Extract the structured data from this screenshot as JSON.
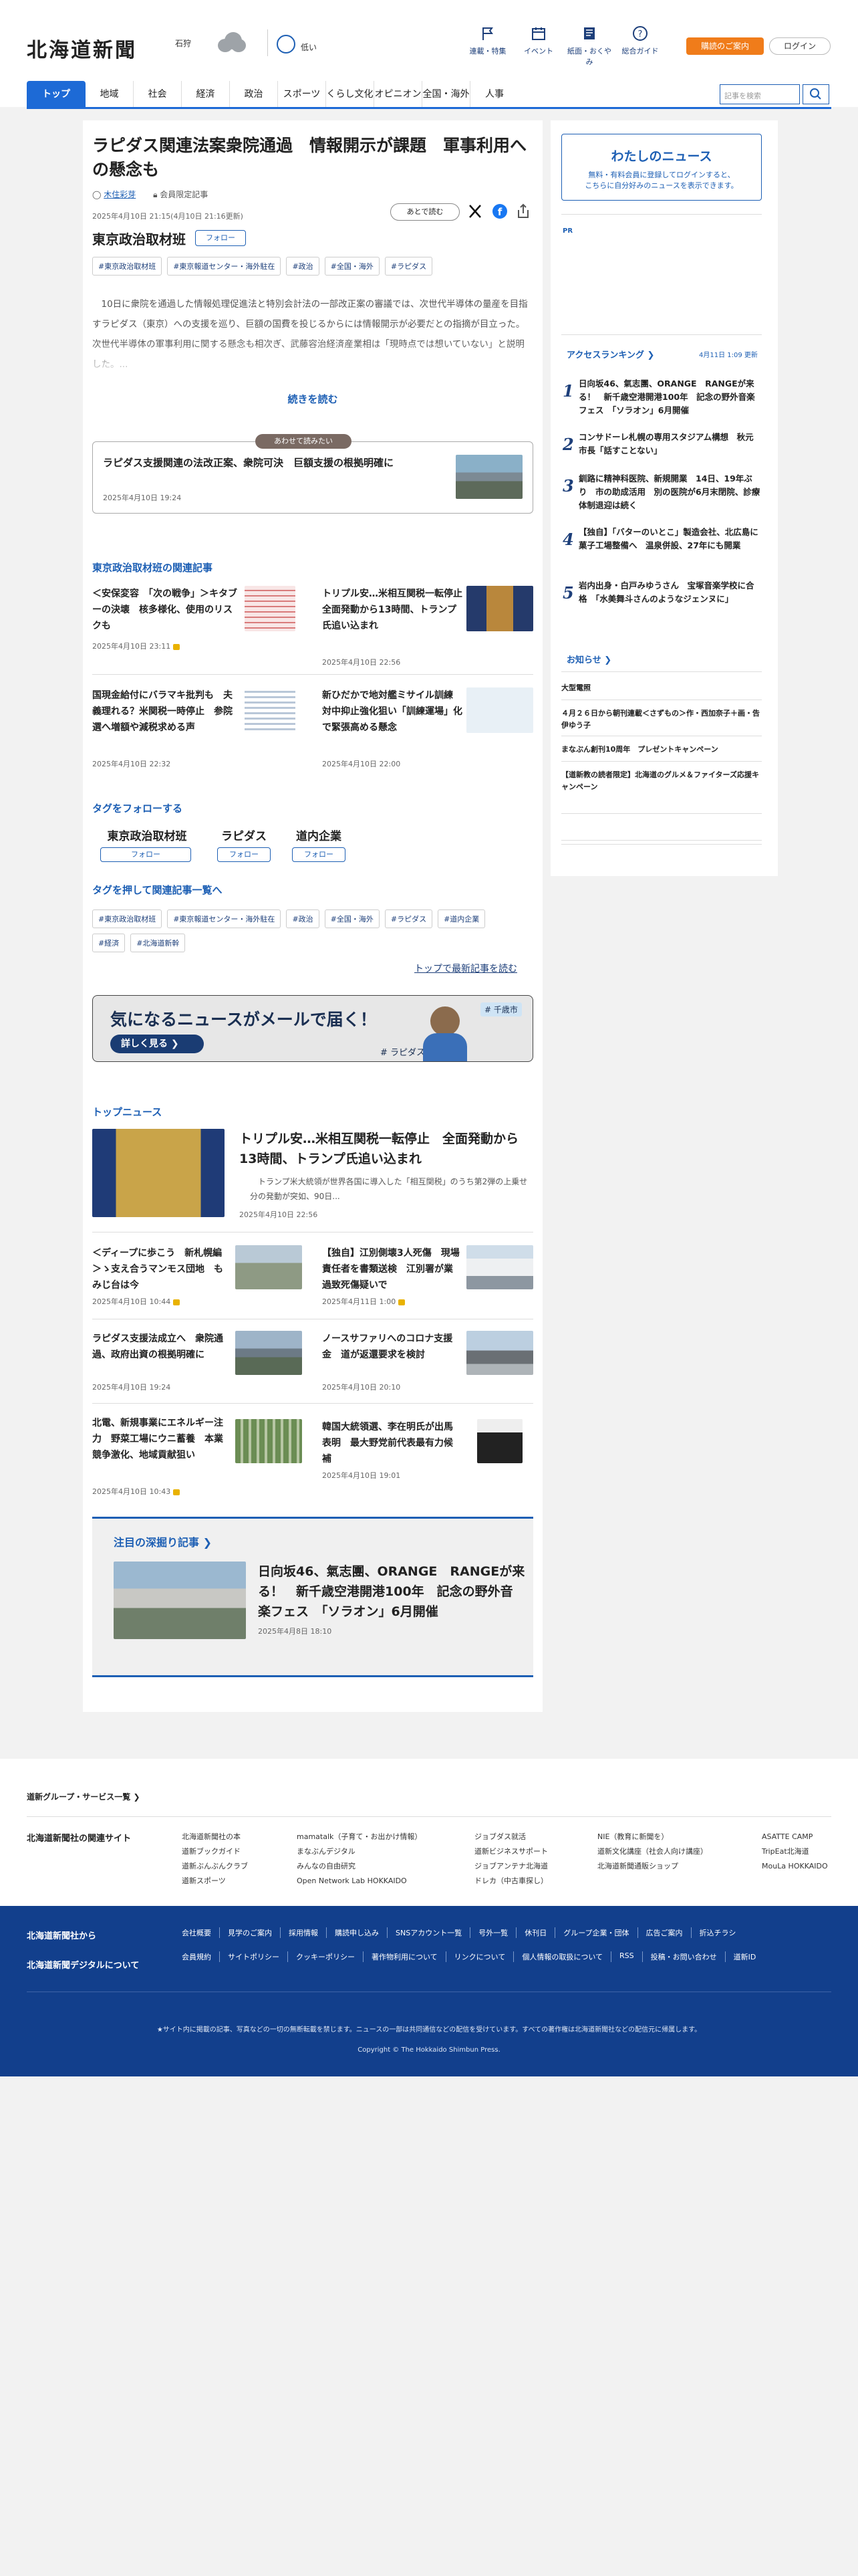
{
  "header": {
    "logo": "北海道新聞",
    "location": "石狩",
    "pollen": "低い",
    "nav": [
      "連載・特集",
      "イベント",
      "紙面・おくやみ",
      "総合ガイド"
    ],
    "subscribe": "購読のご案内",
    "login": "ログイン",
    "search_placeholder": "記事を検索"
  },
  "gnav": [
    "トップ",
    "地域",
    "社会",
    "経済",
    "政治",
    "スポーツ",
    "くらし文化",
    "オピニオン",
    "全国・海外",
    "人事"
  ],
  "article": {
    "title": "ラピダス関連法案衆院通過　情報開示が課題　軍事利用への懸念も",
    "author": "木住彩芽",
    "member": "会員限定記事",
    "date": "2025年4月10日 21:15(4月10日 21:16更新)",
    "save": "あとで読む",
    "section": "東京政治取材班",
    "follow": "フォロー",
    "tags": [
      "#東京政治取材班",
      "#東京報道センター・海外駐在",
      "#政治",
      "#全国・海外",
      "#ラピダス"
    ],
    "lead": "　10日に衆院を通過した情報処理促進法と特別会計法の一部改正案の審議では、次世代半導体の量産を目指すラピダス（東京）への支援を巡り、巨額の国費を投じるからには情報開示が必要だとの指摘が目立った。次世代半導体の軍事利用に関する懸念も相次ぎ、武藤容治経済産業相は「現時点では想いていない」と説明した。...",
    "more": "続きを読む"
  },
  "recommend": {
    "badge": "あわせて読みたい",
    "title": "ラピダス支援関連の法改正案、衆院可決　巨額支援の根拠明確に",
    "date": "2025年4月10日 19:24"
  },
  "related": {
    "heading": "東京政治取材班の関連記事",
    "items": [
      {
        "title": "＜安保変容　「次の戦争」＞キタブーの決壊　核多様化、使用のリスクも",
        "date": "2025年4月10日 23:11"
      },
      {
        "title": "トリプル安…米相互関税一転停止　全面発動から13時間、トランプ氏追い込まれ",
        "date": "2025年4月10日 22:56"
      },
      {
        "title": "国現金給付にバラマキ批判も　夫義理れる？米関税一時停止　参院選へ増額や減税求める声",
        "date": "2025年4月10日 22:32"
      },
      {
        "title": "新ひだかで地対艦ミサイル訓練　対中抑止強化狙い「訓練運場」化で緊張高める懸念",
        "date": "2025年4月10日 22:00"
      }
    ]
  },
  "follow_tags": {
    "heading": "タグをフォローする",
    "items": [
      "東京政治取材班",
      "ラピダス",
      "道内企業"
    ],
    "btn": "フォロー"
  },
  "tag_list": {
    "heading": "タグを押して関連記事一覧へ",
    "items": [
      "#東京政治取材班",
      "#東京報道センター・海外駐在",
      "#政治",
      "#全国・海外",
      "#ラピダス",
      "#道内企業",
      "#経済",
      "#北海道新幹"
    ],
    "link": "トップで最新記事を読む"
  },
  "banner": {
    "title": "気になるニュースがメールで届く！",
    "button": "詳しく見る",
    "tag1": "# ラピダス",
    "tag2": "# 千歳市"
  },
  "top_news": {
    "heading": "トップニュース",
    "main": {
      "title": "トリプル安…米相互関税一転停止　全面発動から13時間、トランプ氏追い込まれ",
      "desc": "　トランプ米大統領が世界各国に導入した「相互関税」のうち第2弾の上乗せ分の発動が突如、90日...",
      "date": "2025年4月10日 22:56"
    },
    "items": [
      {
        "title": "＜ディープに歩こう　新札幌編＞ゝ支え合うマンモス団地　もみじ台は今",
        "date": "2025年4月10日 10:44",
        "lock": true
      },
      {
        "title": "【独自】江別側壊3人死傷　現場責任者を書類送検　江別署が業過致死傷疑いで",
        "date": "2025年4月11日 1:00",
        "lock": true
      },
      {
        "title": "ラピダス支援法成立へ　衆院通過、政府出資の根拠明確に",
        "date": "2025年4月10日 19:24",
        "lock": false
      },
      {
        "title": "ノースサファリへのコロナ支援金　道が返還要求を検討",
        "date": "2025年4月10日 20:10",
        "lock": false
      },
      {
        "title": "北電、新規事業にエネルギー注力　野菜工場にウニ蓄養　本業競争激化、地域貢献狙い",
        "date": "2025年4月10日 10:43",
        "lock": true
      },
      {
        "title": "韓国大統領選、李在明氏が出馬表明　最大野党前代表最有力候補",
        "date": "2025年4月10日 19:01",
        "lock": false
      }
    ]
  },
  "deep": {
    "heading": "注目の深掘り記事",
    "title": "日向坂46、氣志團、ORANGE　RANGEが来る！　新千歳空港開港100年　記念の野外音楽フェス　「ソラオン」6月開催",
    "date": "2025年4月8日 18:10"
  },
  "sidebar": {
    "mynews_title": "わたしのニュース",
    "mynews_desc1": "無料・有料会員に登録してログインすると、",
    "mynews_desc2": "こちらに自分好みのニュースを表示できます。",
    "pr": "PR",
    "ranking_heading": "アクセスランキング",
    "ranking_date": "4月11日 1:09 更新",
    "ranking": [
      "日向坂46、氣志團、ORANGE　RANGEが来る！　新千歳空港開港100年　記念の野外音楽フェス　「ソラオン」6月開催",
      "コンサドーレ札幌の専用スタジアム構想　秋元市長「話すことない」",
      "釧路に精神科医院、新規開業　14日、19年ぶり　市の助成活用　別の医院が6月末閉院、診療体制退迎は続く",
      "【独自】「バターのいとこ」製造会社、北広島に菓子工場整備へ　温泉併設、27年にも開業",
      "岩内出身・白戸みゆうさん　宝塚音楽学校に合格　「水美舞斗さんのようなジェンヌに」"
    ],
    "info_heading": "お知らせ",
    "info": [
      "大型電照",
      "４月２６日から朝刊連載＜さずもの＞作・西加奈子＋画・告伊ゆう子",
      "まなぶん創刊10周年　プレゼントキャンペーン",
      "【道新教の読者限定】北海道のグルメ＆ファイターズ応援キャンペーン"
    ]
  },
  "footer": {
    "group_link": "道新グループ・サービス一覧",
    "rel_heading": "北海道新聞社の関連サイト",
    "rel": [
      [
        "北海道新聞社の本",
        "道新ブックガイド",
        "道新ぶんぶんクラブ",
        "道新スポーツ"
      ],
      [
        "mamatalk（子育て・お出かけ情報）",
        "まなぶんデジタル",
        "みんなの自由研究",
        "Open Network Lab HOKKAIDO"
      ],
      [
        "ジョブダス就活",
        "道新ビジネスサポート",
        "ジョブアンテナ北海道",
        "ドレカ（中古車探し）"
      ],
      [
        "NIE（教育に新聞を）",
        "道新文化講座（社会人向け講座）",
        "北海道新聞通販ショップ"
      ],
      [
        "ASATTE CAMP",
        "TripEat北海道",
        "MouLa HOKKAIDO"
      ]
    ],
    "from_co": "北海道新聞社から",
    "about_digital": "北海道新聞デジタルについて",
    "links1": [
      "会社概要",
      "見学のご案内",
      "採用情報",
      "購読申し込み",
      "SNSアカウント一覧",
      "号外一覧",
      "休刊日",
      "グループ企業・団体",
      "広告ご案内",
      "折込チラシ"
    ],
    "links2": [
      "会員規約",
      "サイトポリシー",
      "クッキーポリシー",
      "著作物利用について",
      "リンクについて",
      "個人情報の取扱について",
      "RSS",
      "投稿・お問い合わせ",
      "道新ID"
    ],
    "notice": "★サイト内に掲載の記事、写真などの一切の無断転載を禁じます。ニュースの一部は共同通信などの配信を受けています。すべての著作権は北海道新聞社などの配信元に帰属します。",
    "copyright": "Copyright © The Hokkaido Shimbun Press."
  }
}
